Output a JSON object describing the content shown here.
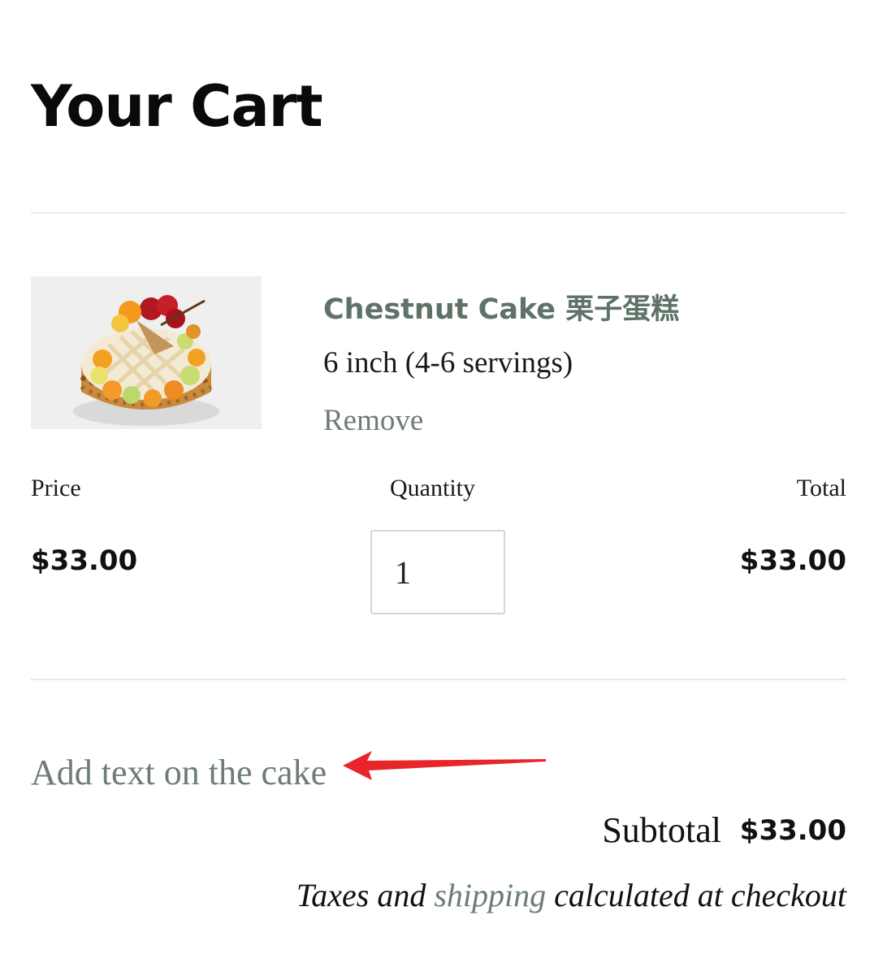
{
  "page": {
    "title": "Your Cart"
  },
  "item": {
    "title": "Chestnut Cake 栗子蛋糕",
    "variant": "6 inch (4-6 servings)",
    "remove_label": "Remove",
    "image_alt": "cake-photo",
    "price": "$33.00",
    "quantity": "1",
    "total": "$33.00"
  },
  "columns": {
    "price": "Price",
    "quantity": "Quantity",
    "total": "Total"
  },
  "note": {
    "link_label": "Add text on the cake"
  },
  "summary": {
    "subtotal_label": "Subtotal",
    "subtotal_value": "$33.00",
    "tax_prefix": "Taxes and",
    "tax_link": "shipping",
    "tax_suffix": "calculated at checkout"
  },
  "colors": {
    "accent": "#5f7268",
    "link": "#6c7d74",
    "annotation": "#e8262a"
  }
}
